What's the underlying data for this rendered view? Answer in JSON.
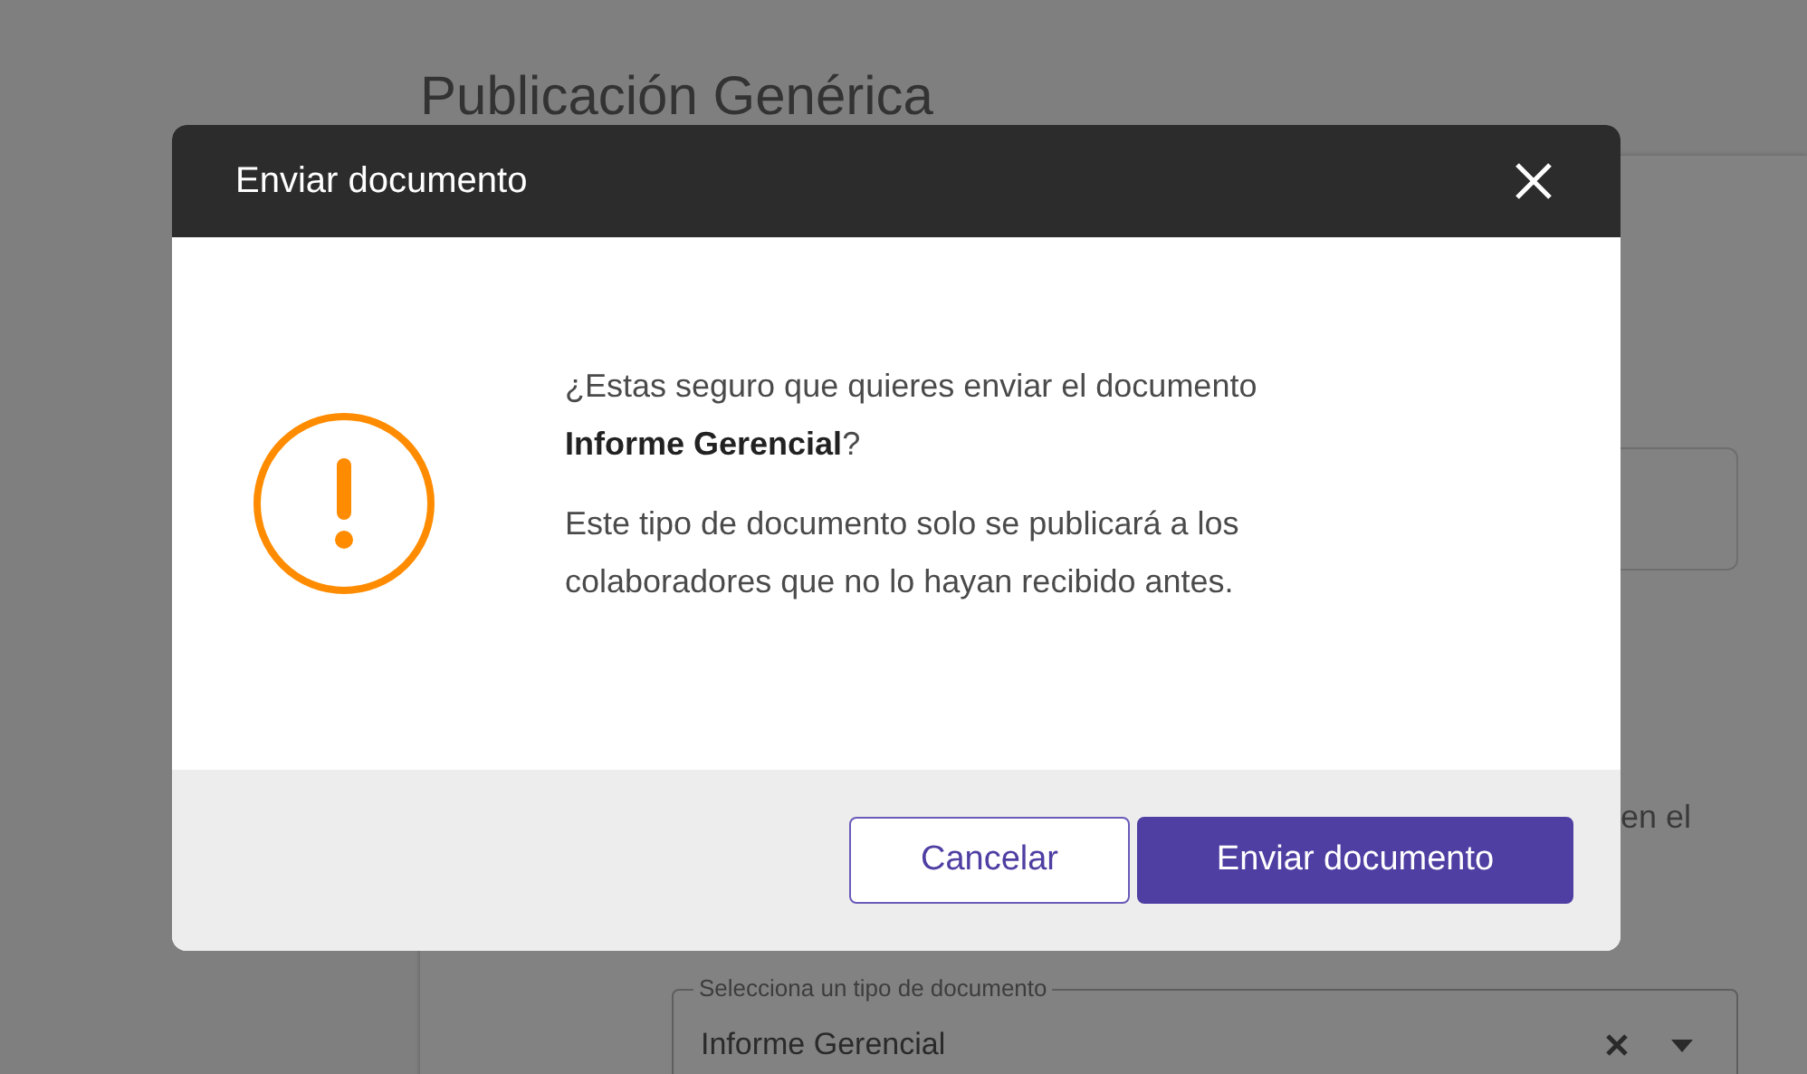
{
  "page": {
    "title": "Publicación Genérica",
    "card": {
      "text_fragment": "en el",
      "select": {
        "label": "Selecciona un tipo de documento",
        "value": "Informe Gerencial"
      }
    }
  },
  "dialog": {
    "title": "Enviar documento",
    "message": "¿Estas seguro que quieres enviar el documento **Informe Gerencial**?",
    "note": "Este tipo de documento solo se publicará a los colaboradores que no lo hayan recibido antes.",
    "buttons": [
      {
        "label": "Cancelar",
        "kind": "secondary"
      },
      {
        "label": "Enviar documento",
        "kind": "primary"
      }
    ]
  }
}
